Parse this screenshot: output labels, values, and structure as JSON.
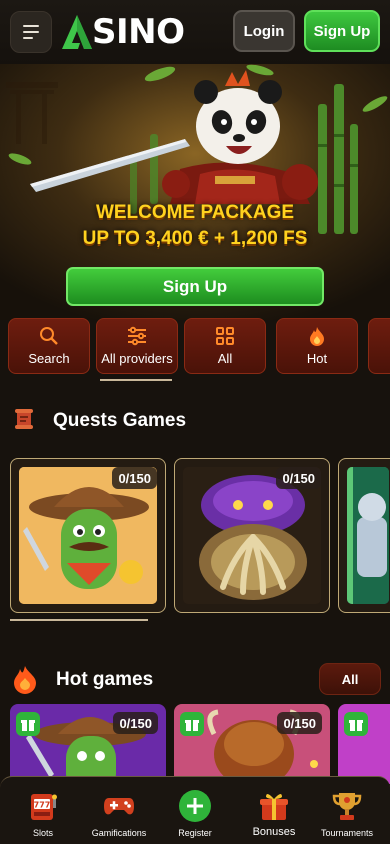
{
  "header": {
    "logo_text": "SINO",
    "login_label": "Login",
    "signup_label": "Sign Up",
    "icons": [
      "menu-icon",
      "logo-a-icon"
    ]
  },
  "banner": {
    "promo_line1": "WELCOME PACKAGE",
    "promo_line2": "UP TO 3,400 € + 1,200 FS",
    "signup_label": "Sign Up"
  },
  "tabs": [
    {
      "label": "Search",
      "icon": "search-icon"
    },
    {
      "label": "All providers",
      "icon": "sliders-icon",
      "selected": true
    },
    {
      "label": "All",
      "icon": "grid-icon"
    },
    {
      "label": "Hot",
      "icon": "flame-icon"
    }
  ],
  "quests": {
    "title": "Quests Games",
    "cards": [
      {
        "counter": "0/150",
        "art": "cactus-cowboy"
      },
      {
        "counter": "0/150",
        "art": "octopus-treasure"
      },
      {
        "counter": "",
        "art": "robot-partial"
      }
    ]
  },
  "hot": {
    "title": "Hot games",
    "all_label": "All",
    "cards": [
      {
        "counter": "0/150",
        "art": "cactus-cowboy"
      },
      {
        "counter": "0/150",
        "art": "buffalo"
      },
      {
        "counter": "",
        "art": "partial"
      }
    ]
  },
  "bottom_nav": [
    {
      "label": "Slots",
      "icon": "slot-machine-icon"
    },
    {
      "label": "Gamifications",
      "icon": "gamepad-icon"
    },
    {
      "label": "Register",
      "icon": "plus-circle-icon"
    },
    {
      "label": "Bonuses",
      "icon": "gift-icon"
    },
    {
      "label": "Tournaments",
      "icon": "trophy-icon"
    }
  ],
  "colors": {
    "accent_green": "#2fb43a",
    "promo_yellow": "#ffd21f",
    "tab_red": "#6e1d0f",
    "background": "#17120d"
  }
}
